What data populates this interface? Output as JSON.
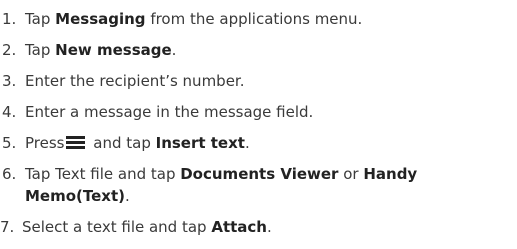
{
  "steps": [
    {
      "num": "1.",
      "pre": "Tap ",
      "bold": "Messaging",
      "post": " from the applications menu."
    },
    {
      "num": "2.",
      "pre": "Tap ",
      "bold": "New message",
      "post": "."
    },
    {
      "num": "3.",
      "text": "Enter the recipient’s number."
    },
    {
      "num": "4.",
      "text": "Enter a message in the message field."
    },
    {
      "num": "5.",
      "pre": "Press",
      "post_icon": " and tap ",
      "bold": "Insert text",
      "post": ".",
      "icon": "menu-icon"
    },
    {
      "num": "6.",
      "pre": "Tap Text file and tap ",
      "bold": "Documents Viewer",
      "mid": " or ",
      "bold2": "Handy",
      "line2_bold": "Memo(Text)",
      "line2_post": "."
    },
    {
      "num": "7.",
      "pre": "Select a text file and tap ",
      "bold": "Attach",
      "post": "."
    }
  ]
}
